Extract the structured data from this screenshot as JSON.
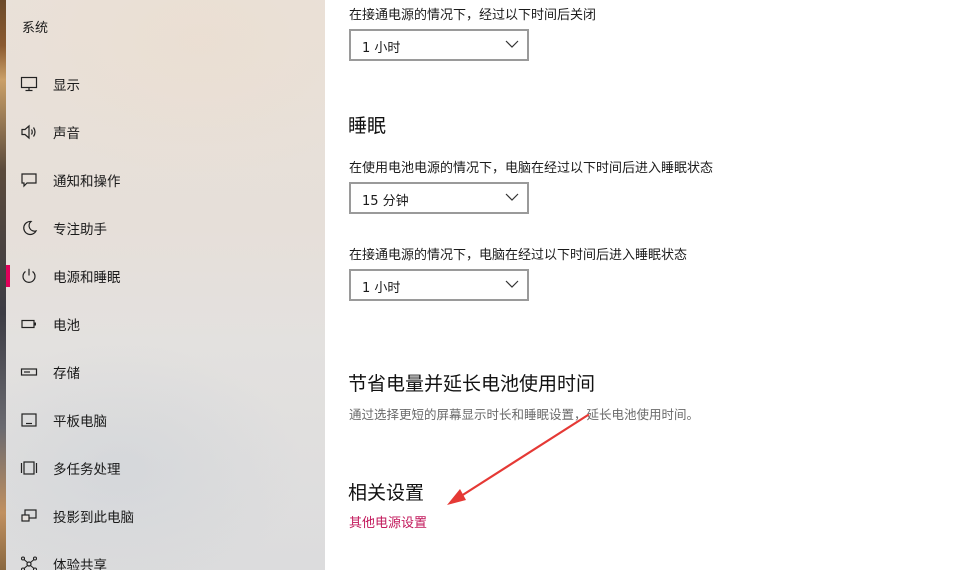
{
  "sidebar": {
    "title": "系统",
    "items": [
      {
        "label": "显示",
        "icon": "display-icon"
      },
      {
        "label": "声音",
        "icon": "speaker-icon"
      },
      {
        "label": "通知和操作",
        "icon": "notification-icon"
      },
      {
        "label": "专注助手",
        "icon": "moon-icon"
      },
      {
        "label": "电源和睡眠",
        "icon": "power-icon",
        "active": true
      },
      {
        "label": "电池",
        "icon": "battery-icon"
      },
      {
        "label": "存储",
        "icon": "storage-icon"
      },
      {
        "label": "平板电脑",
        "icon": "tablet-icon"
      },
      {
        "label": "多任务处理",
        "icon": "multitasking-icon"
      },
      {
        "label": "投影到此电脑",
        "icon": "projection-icon"
      },
      {
        "label": "体验共享",
        "icon": "share-icon"
      }
    ]
  },
  "screen": {
    "plugged_in_label": "在接通电源的情况下，经过以下时间后关闭",
    "plugged_in_value": "1 小时"
  },
  "sleep": {
    "title": "睡眠",
    "battery_label": "在使用电池电源的情况下，电脑在经过以下时间后进入睡眠状态",
    "battery_value": "15 分钟",
    "plugged_in_label": "在接通电源的情况下，电脑在经过以下时间后进入睡眠状态",
    "plugged_in_value": "1 小时"
  },
  "save_power": {
    "title": "节省电量并延长电池使用时间",
    "description": "通过选择更短的屏幕显示时长和睡眠设置，延长电池使用时间。"
  },
  "related": {
    "title": "相关设置",
    "link": "其他电源设置"
  },
  "colors": {
    "accent": "#e0005a",
    "link": "#c2185b",
    "annotation_arrow": "#e53935"
  }
}
